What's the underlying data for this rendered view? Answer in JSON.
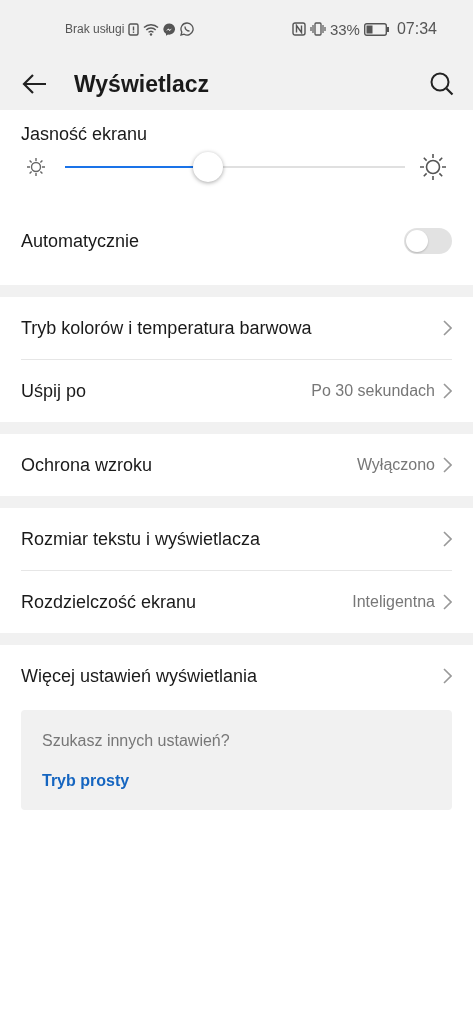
{
  "status_bar": {
    "carrier": "Brak usługi",
    "battery_text": "33%",
    "time": "07:34"
  },
  "header": {
    "title": "Wyświetlacz"
  },
  "brightness": {
    "label": "Jasność ekranu",
    "level": 0.42
  },
  "auto": {
    "label": "Automatycznie",
    "on": false
  },
  "groups": [
    [
      {
        "label": "Tryb kolorów i temperatura barwowa"
      },
      {
        "label": "Uśpij po",
        "value": "Po 30 sekundach"
      }
    ],
    [
      {
        "label": "Ochrona wzroku",
        "value": "Wyłączono"
      }
    ],
    [
      {
        "label": "Rozmiar tekstu i wyświetlacza"
      },
      {
        "label": "Rozdzielczość ekranu",
        "value": "Inteligentna"
      }
    ],
    [
      {
        "label": "Więcej ustawień wyświetlania"
      }
    ]
  ],
  "suggestion": {
    "question": "Szukasz innych ustawień?",
    "link": "Tryb prosty"
  }
}
